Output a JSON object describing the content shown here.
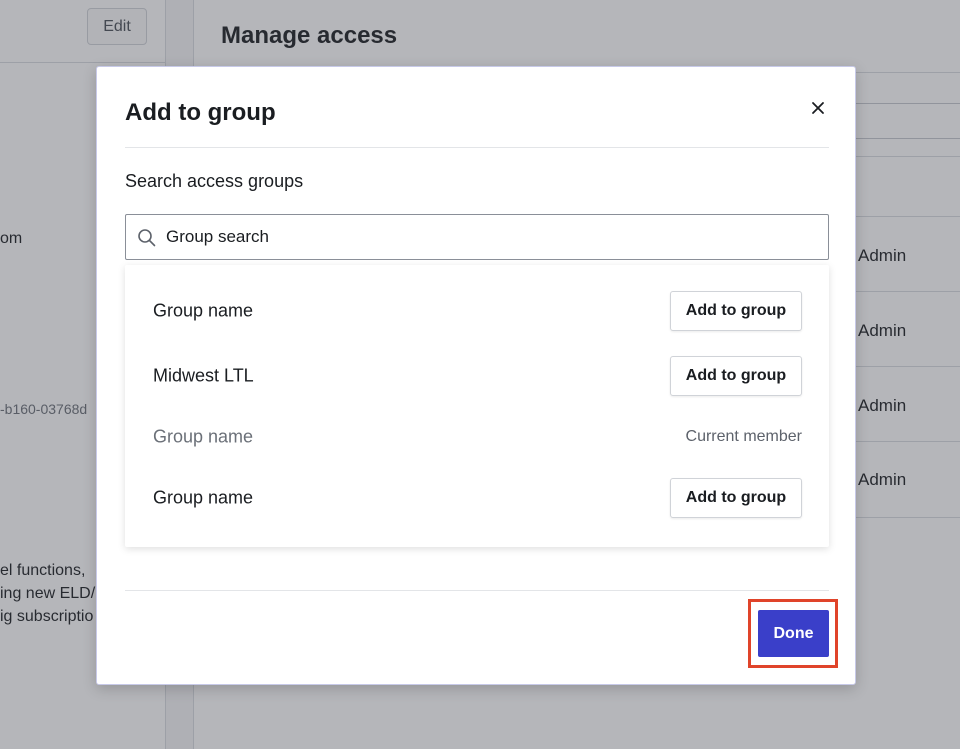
{
  "background": {
    "edit_label": "Edit",
    "left_email_fragment": "om",
    "left_id_fragment": "-b160-03768d",
    "left_desc_lines": [
      "el functions,",
      "ing new ELD/",
      "ig subscriptio"
    ],
    "main_title": "Manage access",
    "role_cells": [
      "Admin",
      "Admin",
      "Admin",
      "Admin"
    ]
  },
  "modal": {
    "title": "Add to group",
    "close_icon": "close-icon",
    "search_label": "Search access groups",
    "search_placeholder": "Group search",
    "search_value": "",
    "results": [
      {
        "name": "Group name",
        "action": "Add to group",
        "member": false
      },
      {
        "name": "Midwest LTL",
        "action": "Add to group",
        "member": false
      },
      {
        "name": "Group name",
        "status": "Current member",
        "member": true
      },
      {
        "name": "Group name",
        "action": "Add to group",
        "member": false
      }
    ],
    "done_label": "Done"
  },
  "colors": {
    "primary": "#3a3fc9",
    "highlight": "#e0442a",
    "overlay": "#3c404a"
  }
}
